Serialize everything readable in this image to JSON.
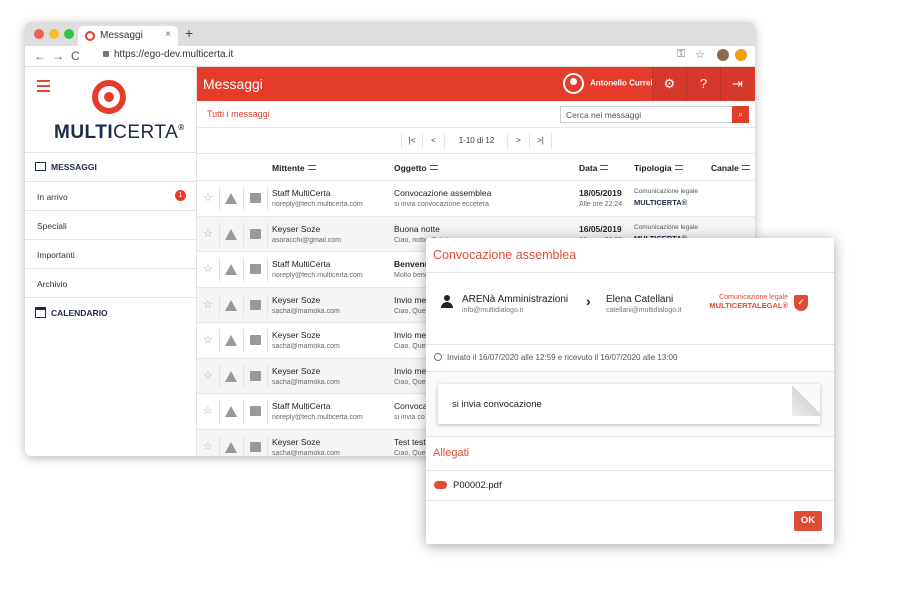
{
  "browser": {
    "tab_title": "Messaggi",
    "tab_close": "×",
    "new_tab": "+",
    "url": "https://ego-dev.multicerta.it",
    "back": "←",
    "forward": "→",
    "reload": "C",
    "key_icon": "⚿",
    "star_icon": "☆"
  },
  "brand": {
    "logo_text_a": "MULTI",
    "logo_text_b": "CERTA",
    "mark": "®"
  },
  "sidebar": {
    "messages_section": "MESSAGGI",
    "items": [
      {
        "label": "In arrivo",
        "badge": "1"
      },
      {
        "label": "Speciali"
      },
      {
        "label": "Importanti"
      },
      {
        "label": "Archivio"
      }
    ],
    "calendar_section": "CALENDARIO"
  },
  "header": {
    "title": "Messaggi",
    "user_name": "Antonello Curreli",
    "settings_icon": "⚙",
    "help_icon": "?",
    "logout_icon": "⇥"
  },
  "subbar": {
    "title": "Tutti i messaggi",
    "search_placeholder": "Cerca nei messaggi",
    "search_icon": "⌕"
  },
  "pager": {
    "first": "|<",
    "prev": "<",
    "count": "1-10 di 12",
    "next": ">",
    "last": ">|"
  },
  "table": {
    "columns": {
      "sender": "Mittente",
      "subject": "Oggetto",
      "date": "Data",
      "type": "Tipologia",
      "channel": "Canale"
    },
    "rows": [
      {
        "sender": "Staff MultiCerta",
        "sender_mail": "noreply@tech.multicerta.com",
        "subject": "Convocazione assemblea",
        "preview": "si invia convocazione eccetera",
        "date": "18/05/2019",
        "time": "Alle ore 22:24",
        "type1": "Comunicazione legale",
        "type2": "MULTICERTA®",
        "bold": false
      },
      {
        "sender": "Keyser Soze",
        "sender_mail": "asoracchi@gmail.com",
        "subject": "Buona notte",
        "preview": "Ciao, notte, Saluti",
        "date": "16/05/2019",
        "time": "Alle ore 23:09",
        "type1": "Comunicazione legale",
        "type2": "MULTICERTA®",
        "bold": false
      },
      {
        "sender": "Staff MultiCerta",
        "sender_mail": "noreply@tech.multicerta.com",
        "subject": "Benvenut",
        "preview": "Molto bene",
        "date": "",
        "time": "",
        "type1": "",
        "type2": "",
        "bold": true
      },
      {
        "sender": "Keyser Soze",
        "sender_mail": "sacha@mamoka.com",
        "subject": "Invio mes",
        "preview": "Ciao, Ques",
        "date": "",
        "time": "",
        "type1": "",
        "type2": "",
        "bold": false
      },
      {
        "sender": "Keyser Soze",
        "sender_mail": "sacha@mamoka.com",
        "subject": "Invio mes",
        "preview": "Ciao, Ques",
        "date": "",
        "time": "",
        "type1": "",
        "type2": "",
        "bold": false
      },
      {
        "sender": "Keyser Soze",
        "sender_mail": "sacha@mamoka.com",
        "subject": "Invio mes",
        "preview": "Ciao, Ques",
        "date": "",
        "time": "",
        "type1": "",
        "type2": "",
        "bold": false
      },
      {
        "sender": "Staff MultiCerta",
        "sender_mail": "noreply@tech.multicerta.com",
        "subject": "Convoca",
        "preview": "si invia co",
        "date": "",
        "time": "",
        "type1": "",
        "type2": "",
        "bold": false
      },
      {
        "sender": "Keyser Soze",
        "sender_mail": "sacha@mamoka.com",
        "subject": "Test test",
        "preview": "Ciao, Ques",
        "date": "",
        "time": "",
        "type1": "",
        "type2": "",
        "bold": false
      }
    ]
  },
  "modal": {
    "title": "Convocazione assemblea",
    "sender_name": "ARENà Amministrazioni",
    "sender_mail": "info@multidialogo.it",
    "arrow": "›",
    "recipient_name": "Elena Catellani",
    "recipient_mail": "catellani@multidialogo.it",
    "logo_line1": "Comunicazione legale",
    "logo_line2": "MULTICERTALEGAL®",
    "shield_check": "✓",
    "date_line": "Inviato il 16/07/2020 alle 12:59 e ricevuto il 16/07/2020 alle 13:00",
    "body": "si invia convocazione",
    "attachments_title": "Allegati",
    "attachment": "P00002.pdf",
    "ok": "OK"
  },
  "colors": {
    "brand_red": "#e53b2b",
    "navy": "#1e2a4a"
  }
}
